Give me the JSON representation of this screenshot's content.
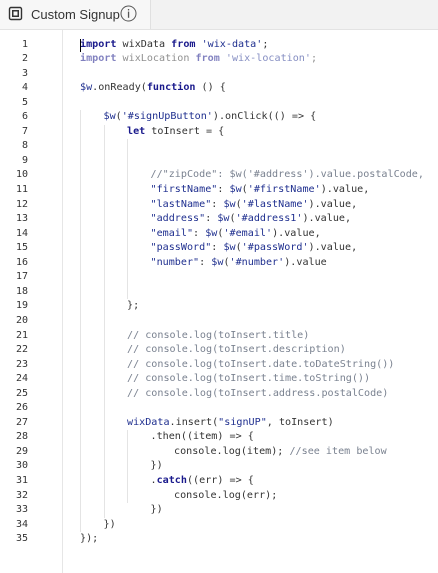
{
  "tab": {
    "title": "Custom Signup",
    "icon": "page-code-icon",
    "info_icon": "info-icon"
  },
  "colors": {
    "keyword": "#1a1a8c",
    "string": "#1f2f8f",
    "comment": "#7a8290",
    "text": "#333333"
  },
  "line_numbers": [
    "1",
    "2",
    "3",
    "4",
    "5",
    "6",
    "7",
    "8",
    "9",
    "10",
    "11",
    "12",
    "13",
    "14",
    "15",
    "16",
    "17",
    "18",
    "19",
    "20",
    "21",
    "22",
    "23",
    "24",
    "25",
    "26",
    "27",
    "28",
    "29",
    "30",
    "31",
    "32",
    "33",
    "34",
    "35"
  ],
  "lines": [
    {
      "indent": 0,
      "faint": false,
      "tokens": [
        [
          "kw",
          "import"
        ],
        [
          "id",
          " wixData "
        ],
        [
          "kw",
          "from"
        ],
        [
          "id",
          " "
        ],
        [
          "str",
          "'wix-data'"
        ],
        [
          "id",
          ";"
        ]
      ]
    },
    {
      "indent": 0,
      "faint": true,
      "tokens": [
        [
          "kw",
          "import"
        ],
        [
          "id",
          " wixLocation "
        ],
        [
          "kw",
          "from"
        ],
        [
          "id",
          " "
        ],
        [
          "str",
          "'wix-location'"
        ],
        [
          "id",
          ";"
        ]
      ]
    },
    {
      "indent": 0,
      "faint": false,
      "tokens": []
    },
    {
      "indent": 0,
      "faint": false,
      "tokens": [
        [
          "obj",
          "$w"
        ],
        [
          "id",
          ".onReady("
        ],
        [
          "kw",
          "function"
        ],
        [
          "id",
          " () {"
        ]
      ]
    },
    {
      "indent": 0,
      "faint": false,
      "tokens": []
    },
    {
      "indent": 1,
      "faint": false,
      "tokens": [
        [
          "obj",
          "$w"
        ],
        [
          "id",
          "("
        ],
        [
          "str",
          "'#signUpButton'"
        ],
        [
          "id",
          ").onClick(() => {"
        ]
      ]
    },
    {
      "indent": 2,
      "faint": false,
      "tokens": [
        [
          "kw",
          "let"
        ],
        [
          "id",
          " toInsert = {"
        ]
      ]
    },
    {
      "indent": 0,
      "faint": false,
      "tokens": []
    },
    {
      "indent": 0,
      "faint": false,
      "tokens": []
    },
    {
      "indent": 3,
      "faint": false,
      "tokens": [
        [
          "com",
          "//\"zipCode\": $w('#address').value.postalCode,"
        ]
      ]
    },
    {
      "indent": 3,
      "faint": false,
      "tokens": [
        [
          "str",
          "\"firstName\""
        ],
        [
          "id",
          ": "
        ],
        [
          "obj",
          "$w"
        ],
        [
          "id",
          "("
        ],
        [
          "str",
          "'#firstName'"
        ],
        [
          "id",
          ").value,"
        ]
      ]
    },
    {
      "indent": 3,
      "faint": false,
      "tokens": [
        [
          "str",
          "\"lastName\""
        ],
        [
          "id",
          ": "
        ],
        [
          "obj",
          "$w"
        ],
        [
          "id",
          "("
        ],
        [
          "str",
          "'#lastName'"
        ],
        [
          "id",
          ").value,"
        ]
      ]
    },
    {
      "indent": 3,
      "faint": false,
      "tokens": [
        [
          "str",
          "\"address\""
        ],
        [
          "id",
          ": "
        ],
        [
          "obj",
          "$w"
        ],
        [
          "id",
          "("
        ],
        [
          "str",
          "'#address1'"
        ],
        [
          "id",
          ").value,"
        ]
      ]
    },
    {
      "indent": 3,
      "faint": false,
      "tokens": [
        [
          "str",
          "\"email\""
        ],
        [
          "id",
          ": "
        ],
        [
          "obj",
          "$w"
        ],
        [
          "id",
          "("
        ],
        [
          "str",
          "'#email'"
        ],
        [
          "id",
          ").value,"
        ]
      ]
    },
    {
      "indent": 3,
      "faint": false,
      "tokens": [
        [
          "str",
          "\"passWord\""
        ],
        [
          "id",
          ": "
        ],
        [
          "obj",
          "$w"
        ],
        [
          "id",
          "("
        ],
        [
          "str",
          "'#passWord'"
        ],
        [
          "id",
          ").value,"
        ]
      ]
    },
    {
      "indent": 3,
      "faint": false,
      "tokens": [
        [
          "str",
          "\"number\""
        ],
        [
          "id",
          ": "
        ],
        [
          "obj",
          "$w"
        ],
        [
          "id",
          "("
        ],
        [
          "str",
          "'#number'"
        ],
        [
          "id",
          ").value"
        ]
      ]
    },
    {
      "indent": 0,
      "faint": false,
      "tokens": []
    },
    {
      "indent": 0,
      "faint": false,
      "tokens": []
    },
    {
      "indent": 2,
      "faint": false,
      "tokens": [
        [
          "id",
          "};"
        ]
      ]
    },
    {
      "indent": 0,
      "faint": false,
      "tokens": []
    },
    {
      "indent": 2,
      "faint": false,
      "tokens": [
        [
          "com",
          "// console.log(toInsert.title)"
        ]
      ]
    },
    {
      "indent": 2,
      "faint": false,
      "tokens": [
        [
          "com",
          "// console.log(toInsert.description)"
        ]
      ]
    },
    {
      "indent": 2,
      "faint": false,
      "tokens": [
        [
          "com",
          "// console.log(toInsert.date.toDateString())"
        ]
      ]
    },
    {
      "indent": 2,
      "faint": false,
      "tokens": [
        [
          "com",
          "// console.log(toInsert.time.toString())"
        ]
      ]
    },
    {
      "indent": 2,
      "faint": false,
      "tokens": [
        [
          "com",
          "// console.log(toInsert.address.postalCode)"
        ]
      ]
    },
    {
      "indent": 0,
      "faint": false,
      "tokens": []
    },
    {
      "indent": 2,
      "faint": false,
      "tokens": [
        [
          "obj",
          "wixData"
        ],
        [
          "id",
          ".insert("
        ],
        [
          "str",
          "\"signUP\""
        ],
        [
          "id",
          ", toInsert)"
        ]
      ]
    },
    {
      "indent": 3,
      "faint": false,
      "tokens": [
        [
          "id",
          ".then((item) => {"
        ]
      ]
    },
    {
      "indent": 4,
      "faint": false,
      "tokens": [
        [
          "id",
          "console.log(item); "
        ],
        [
          "com",
          "//see item below"
        ]
      ]
    },
    {
      "indent": 3,
      "faint": false,
      "tokens": [
        [
          "id",
          "})"
        ]
      ]
    },
    {
      "indent": 3,
      "faint": false,
      "tokens": [
        [
          "id",
          "."
        ],
        [
          "kw",
          "catch"
        ],
        [
          "id",
          "((err) => {"
        ]
      ]
    },
    {
      "indent": 4,
      "faint": false,
      "tokens": [
        [
          "id",
          "console.log(err);"
        ]
      ]
    },
    {
      "indent": 3,
      "faint": false,
      "tokens": [
        [
          "id",
          "})"
        ]
      ]
    },
    {
      "indent": 1,
      "faint": false,
      "tokens": [
        [
          "id",
          "})"
        ]
      ]
    },
    {
      "indent": 0,
      "faint": false,
      "tokens": [
        [
          "id",
          "});"
        ]
      ]
    }
  ]
}
